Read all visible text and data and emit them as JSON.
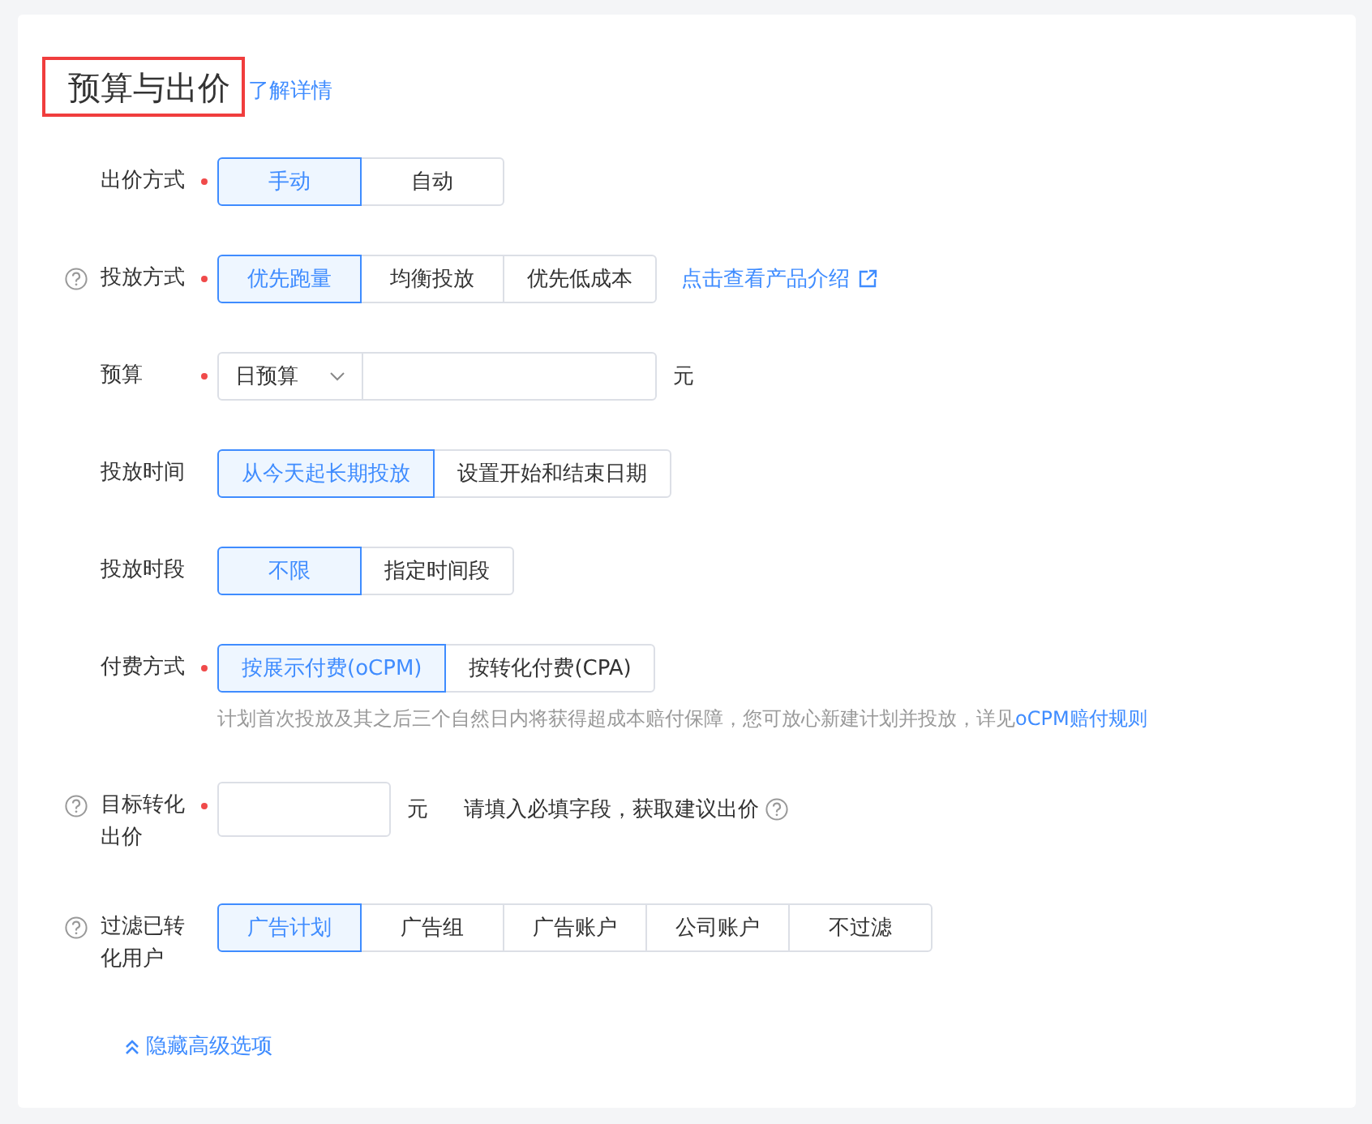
{
  "section": {
    "title": "预算与出价",
    "highlighted": true,
    "link": "了解详情"
  },
  "fields": [
    {
      "kind": "segmented",
      "label": "出价方式",
      "help": false,
      "required": true,
      "options": [
        {
          "label": "手动",
          "selected": true
        },
        {
          "label": "自动",
          "selected": false
        }
      ]
    },
    {
      "kind": "segmented",
      "label": "投放方式",
      "help": true,
      "required": true,
      "options": [
        {
          "label": "优先跑量",
          "selected": true
        },
        {
          "label": "均衡投放",
          "selected": false
        },
        {
          "label": "优先低成本",
          "selected": false
        }
      ],
      "link": "点击查看产品介绍"
    },
    {
      "kind": "budget",
      "label": "预算",
      "help": false,
      "required": true,
      "select": "日预算",
      "unit": "元"
    },
    {
      "kind": "segmented",
      "label": "投放时间",
      "help": false,
      "required": false,
      "options": [
        {
          "label": "从今天起长期投放",
          "selected": true
        },
        {
          "label": "设置开始和结束日期",
          "selected": false
        }
      ]
    },
    {
      "kind": "segmented",
      "label": "投放时段",
      "help": false,
      "required": false,
      "options": [
        {
          "label": "不限",
          "selected": true
        },
        {
          "label": "指定时间段",
          "selected": false
        }
      ]
    },
    {
      "kind": "segmented",
      "label": "付费方式",
      "help": false,
      "required": true,
      "options": [
        {
          "label": "按展示付费(oCPM)",
          "selected": true
        },
        {
          "label": "按转化付费(CPA)",
          "selected": false
        }
      ],
      "note": "计划首次投放及其之后三个自然日内将获得超成本赔付保障，您可放心新建计划并投放，详见",
      "note_link": "oCPM赔付规则"
    },
    {
      "kind": "bid",
      "label": "目标转化出价",
      "help": true,
      "required": true,
      "unit": "元",
      "hint": "请填入必填字段，获取建议出价"
    },
    {
      "kind": "segmented",
      "label": "过滤已转化用户",
      "help": true,
      "required": false,
      "options": [
        {
          "label": "广告计划",
          "selected": true
        },
        {
          "label": "广告组",
          "selected": false
        },
        {
          "label": "广告账户",
          "selected": false
        },
        {
          "label": "公司账户",
          "selected": false
        },
        {
          "label": "不过滤",
          "selected": false
        }
      ]
    }
  ],
  "advanced_toggle": "隐藏高级选项"
}
